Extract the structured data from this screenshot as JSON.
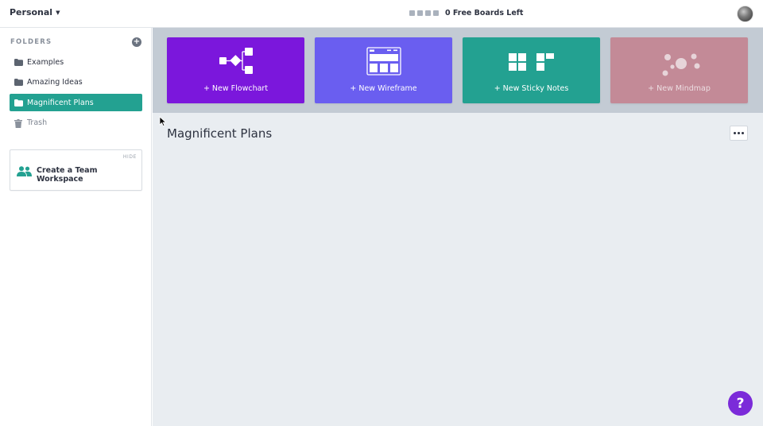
{
  "topbar": {
    "workspace_label": "Personal",
    "boards_left_text": "0 Free Boards Left"
  },
  "sidebar": {
    "folders_header": "FOLDERS",
    "add_folder_symbol": "+",
    "folders": [
      {
        "label": "Examples",
        "active": false,
        "icon": "folder-icon"
      },
      {
        "label": "Amazing Ideas",
        "active": false,
        "icon": "folder-icon"
      },
      {
        "label": "Magnificent Plans",
        "active": true,
        "icon": "folder-icon"
      },
      {
        "label": "Trash",
        "active": false,
        "icon": "trash-icon"
      }
    ],
    "team_card": {
      "hide_label": "HIDE",
      "label": "Create a Team Workspace"
    }
  },
  "tiles": [
    {
      "label": "+ New Flowchart",
      "color": "#7b17dc",
      "icon": "flowchart-icon"
    },
    {
      "label": "+ New Wireframe",
      "color": "#6a5ef0",
      "icon": "wireframe-icon"
    },
    {
      "label": "+ New Sticky Notes",
      "color": "#23a191",
      "icon": "sticky-notes-icon"
    },
    {
      "label": "+ New Mindmap",
      "color": "#c38a97",
      "icon": "mindmap-icon"
    }
  ],
  "main": {
    "board_title": "Magnificent Plans"
  },
  "help_button_label": "?",
  "colors": {
    "accent_teal": "#23a191",
    "accent_purple": "#7b2bd9",
    "band": "#c3cbd4",
    "canvas": "#e9edf1"
  }
}
